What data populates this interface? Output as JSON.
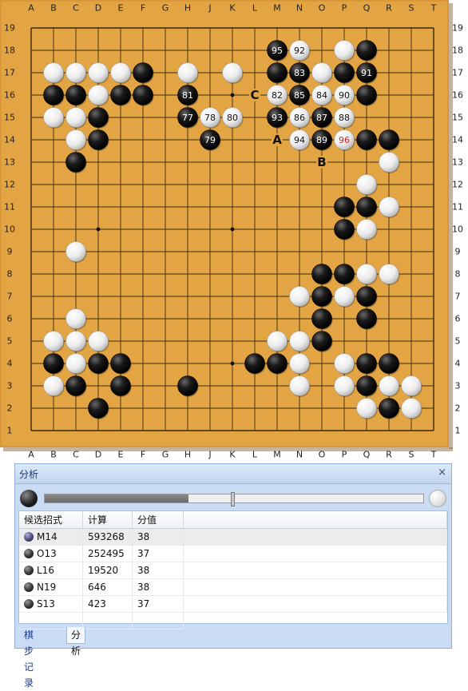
{
  "board": {
    "columns": [
      "A",
      "B",
      "C",
      "D",
      "E",
      "F",
      "G",
      "H",
      "J",
      "K",
      "L",
      "M",
      "N",
      "O",
      "P",
      "Q",
      "R",
      "S",
      "T"
    ],
    "rows": [
      "19",
      "18",
      "17",
      "16",
      "15",
      "14",
      "13",
      "12",
      "11",
      "10",
      "9",
      "8",
      "7",
      "6",
      "5",
      "4",
      "3",
      "2",
      "1"
    ],
    "stones": [
      {
        "c": "M",
        "r": 18,
        "color": "black",
        "label": "95"
      },
      {
        "c": "N",
        "r": 18,
        "color": "white",
        "label": "92"
      },
      {
        "c": "P",
        "r": 18,
        "color": "white",
        "label": ""
      },
      {
        "c": "Q",
        "r": 18,
        "color": "black",
        "label": ""
      },
      {
        "c": "B",
        "r": 17,
        "color": "white",
        "label": ""
      },
      {
        "c": "C",
        "r": 17,
        "color": "white",
        "label": ""
      },
      {
        "c": "D",
        "r": 17,
        "color": "white",
        "label": ""
      },
      {
        "c": "E",
        "r": 17,
        "color": "white",
        "label": ""
      },
      {
        "c": "F",
        "r": 17,
        "color": "black",
        "label": ""
      },
      {
        "c": "H",
        "r": 17,
        "color": "white",
        "label": ""
      },
      {
        "c": "K",
        "r": 17,
        "color": "white",
        "label": ""
      },
      {
        "c": "M",
        "r": 17,
        "color": "black",
        "label": ""
      },
      {
        "c": "N",
        "r": 17,
        "color": "black",
        "label": "83"
      },
      {
        "c": "O",
        "r": 17,
        "color": "white",
        "label": ""
      },
      {
        "c": "P",
        "r": 17,
        "color": "black",
        "label": ""
      },
      {
        "c": "Q",
        "r": 17,
        "color": "black",
        "label": "91"
      },
      {
        "c": "B",
        "r": 16,
        "color": "black",
        "label": ""
      },
      {
        "c": "C",
        "r": 16,
        "color": "black",
        "label": ""
      },
      {
        "c": "D",
        "r": 16,
        "color": "white",
        "label": ""
      },
      {
        "c": "E",
        "r": 16,
        "color": "black",
        "label": ""
      },
      {
        "c": "F",
        "r": 16,
        "color": "black",
        "label": ""
      },
      {
        "c": "H",
        "r": 16,
        "color": "black",
        "label": "81"
      },
      {
        "c": "M",
        "r": 16,
        "color": "white",
        "label": "82"
      },
      {
        "c": "N",
        "r": 16,
        "color": "black",
        "label": "85"
      },
      {
        "c": "O",
        "r": 16,
        "color": "white",
        "label": "84"
      },
      {
        "c": "P",
        "r": 16,
        "color": "white",
        "label": "90"
      },
      {
        "c": "Q",
        "r": 16,
        "color": "black",
        "label": ""
      },
      {
        "c": "B",
        "r": 15,
        "color": "white",
        "label": ""
      },
      {
        "c": "C",
        "r": 15,
        "color": "white",
        "label": ""
      },
      {
        "c": "D",
        "r": 15,
        "color": "black",
        "label": ""
      },
      {
        "c": "H",
        "r": 15,
        "color": "black",
        "label": "77"
      },
      {
        "c": "J",
        "r": 15,
        "color": "white",
        "label": "78"
      },
      {
        "c": "K",
        "r": 15,
        "color": "white",
        "label": "80"
      },
      {
        "c": "M",
        "r": 15,
        "color": "black",
        "label": "93"
      },
      {
        "c": "N",
        "r": 15,
        "color": "white",
        "label": "86"
      },
      {
        "c": "O",
        "r": 15,
        "color": "black",
        "label": "87"
      },
      {
        "c": "P",
        "r": 15,
        "color": "white",
        "label": "88"
      },
      {
        "c": "C",
        "r": 14,
        "color": "white",
        "label": ""
      },
      {
        "c": "D",
        "r": 14,
        "color": "black",
        "label": ""
      },
      {
        "c": "J",
        "r": 14,
        "color": "black",
        "label": "79"
      },
      {
        "c": "N",
        "r": 14,
        "color": "white",
        "label": "94"
      },
      {
        "c": "O",
        "r": 14,
        "color": "black",
        "label": "89"
      },
      {
        "c": "P",
        "r": 14,
        "color": "white",
        "label": "96",
        "last": true
      },
      {
        "c": "Q",
        "r": 14,
        "color": "black",
        "label": ""
      },
      {
        "c": "R",
        "r": 14,
        "color": "black",
        "label": ""
      },
      {
        "c": "C",
        "r": 13,
        "color": "black",
        "label": ""
      },
      {
        "c": "R",
        "r": 13,
        "color": "white",
        "label": ""
      },
      {
        "c": "Q",
        "r": 12,
        "color": "white",
        "label": ""
      },
      {
        "c": "P",
        "r": 11,
        "color": "black",
        "label": ""
      },
      {
        "c": "Q",
        "r": 11,
        "color": "black",
        "label": ""
      },
      {
        "c": "R",
        "r": 11,
        "color": "white",
        "label": ""
      },
      {
        "c": "P",
        "r": 10,
        "color": "black",
        "label": ""
      },
      {
        "c": "Q",
        "r": 10,
        "color": "white",
        "label": ""
      },
      {
        "c": "C",
        "r": 9,
        "color": "white",
        "label": ""
      },
      {
        "c": "O",
        "r": 8,
        "color": "black",
        "label": ""
      },
      {
        "c": "P",
        "r": 8,
        "color": "black",
        "label": ""
      },
      {
        "c": "Q",
        "r": 8,
        "color": "white",
        "label": ""
      },
      {
        "c": "R",
        "r": 8,
        "color": "white",
        "label": ""
      },
      {
        "c": "N",
        "r": 7,
        "color": "white",
        "label": ""
      },
      {
        "c": "O",
        "r": 7,
        "color": "black",
        "label": ""
      },
      {
        "c": "P",
        "r": 7,
        "color": "white",
        "label": ""
      },
      {
        "c": "Q",
        "r": 7,
        "color": "black",
        "label": ""
      },
      {
        "c": "C",
        "r": 6,
        "color": "white",
        "label": ""
      },
      {
        "c": "O",
        "r": 6,
        "color": "black",
        "label": ""
      },
      {
        "c": "Q",
        "r": 6,
        "color": "black",
        "label": ""
      },
      {
        "c": "B",
        "r": 5,
        "color": "white",
        "label": ""
      },
      {
        "c": "C",
        "r": 5,
        "color": "white",
        "label": ""
      },
      {
        "c": "D",
        "r": 5,
        "color": "white",
        "label": ""
      },
      {
        "c": "M",
        "r": 5,
        "color": "white",
        "label": ""
      },
      {
        "c": "N",
        "r": 5,
        "color": "white",
        "label": ""
      },
      {
        "c": "O",
        "r": 5,
        "color": "black",
        "label": ""
      },
      {
        "c": "B",
        "r": 4,
        "color": "black",
        "label": ""
      },
      {
        "c": "C",
        "r": 4,
        "color": "white",
        "label": ""
      },
      {
        "c": "D",
        "r": 4,
        "color": "black",
        "label": ""
      },
      {
        "c": "E",
        "r": 4,
        "color": "black",
        "label": ""
      },
      {
        "c": "L",
        "r": 4,
        "color": "black",
        "label": ""
      },
      {
        "c": "M",
        "r": 4,
        "color": "black",
        "label": ""
      },
      {
        "c": "N",
        "r": 4,
        "color": "white",
        "label": ""
      },
      {
        "c": "P",
        "r": 4,
        "color": "white",
        "label": ""
      },
      {
        "c": "Q",
        "r": 4,
        "color": "black",
        "label": ""
      },
      {
        "c": "R",
        "r": 4,
        "color": "black",
        "label": ""
      },
      {
        "c": "B",
        "r": 3,
        "color": "white",
        "label": ""
      },
      {
        "c": "C",
        "r": 3,
        "color": "black",
        "label": ""
      },
      {
        "c": "E",
        "r": 3,
        "color": "black",
        "label": ""
      },
      {
        "c": "H",
        "r": 3,
        "color": "black",
        "label": ""
      },
      {
        "c": "N",
        "r": 3,
        "color": "white",
        "label": ""
      },
      {
        "c": "P",
        "r": 3,
        "color": "white",
        "label": ""
      },
      {
        "c": "Q",
        "r": 3,
        "color": "black",
        "label": ""
      },
      {
        "c": "R",
        "r": 3,
        "color": "white",
        "label": ""
      },
      {
        "c": "S",
        "r": 3,
        "color": "white",
        "label": ""
      },
      {
        "c": "D",
        "r": 2,
        "color": "black",
        "label": ""
      },
      {
        "c": "Q",
        "r": 2,
        "color": "white",
        "label": ""
      },
      {
        "c": "R",
        "r": 2,
        "color": "black",
        "label": ""
      },
      {
        "c": "S",
        "r": 2,
        "color": "white",
        "label": ""
      }
    ],
    "marks": [
      {
        "c": "L",
        "r": 16,
        "text": "C"
      },
      {
        "c": "M",
        "r": 14,
        "text": "A"
      },
      {
        "c": "O",
        "r": 13,
        "text": "B"
      }
    ],
    "colors": {
      "wood": "#e3a544",
      "line": "#3b2a10",
      "last_move": "#cc2222",
      "frame": "#c98a2e"
    }
  },
  "panel": {
    "title": "分析",
    "close": "×",
    "slider_fraction": 0.38,
    "columns": [
      "候选招式",
      "计算",
      "分值"
    ],
    "rows": [
      {
        "move": "M14",
        "count": "593268",
        "score": "38"
      },
      {
        "move": "O13",
        "count": "252495",
        "score": "37"
      },
      {
        "move": "L16",
        "count": "19520",
        "score": "38"
      },
      {
        "move": "N19",
        "count": "646",
        "score": "38"
      },
      {
        "move": "S13",
        "count": "423",
        "score": "37"
      }
    ],
    "tabs": [
      "棋步记录",
      "分析"
    ]
  }
}
